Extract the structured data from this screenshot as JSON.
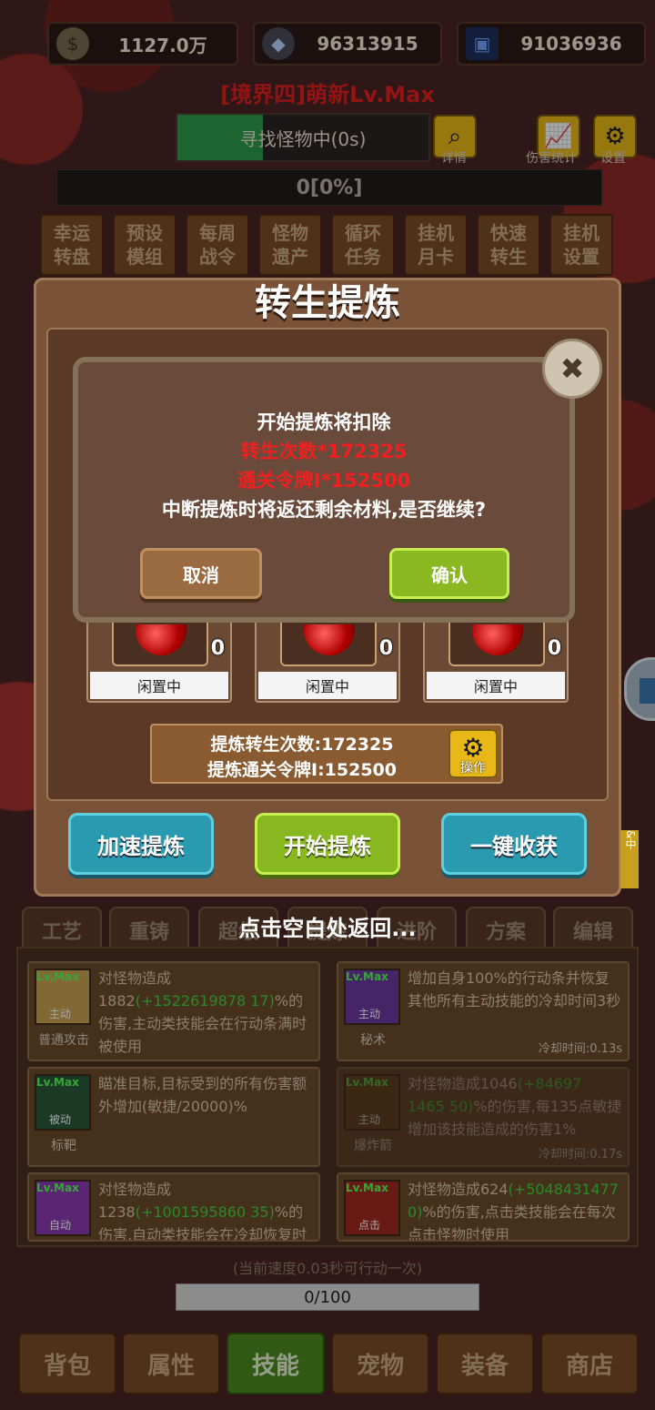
{
  "resources": {
    "gold": "1127.0万",
    "crystal": "96313915",
    "cards": "91036936"
  },
  "realm_title": "[境界四]萌新Lv.Max",
  "search": {
    "label": "寻找怪物中(0s)",
    "detail_label": "详情",
    "progress_fraction": 0.34
  },
  "top_icons": {
    "damage_stats": "伤害统计",
    "settings": "设置"
  },
  "exp_progress": "0[0%]",
  "menu": [
    {
      "l1": "幸运",
      "l2": "转盘"
    },
    {
      "l1": "预设",
      "l2": "模组"
    },
    {
      "l1": "每周",
      "l2": "战令"
    },
    {
      "l1": "怪物",
      "l2": "遗产"
    },
    {
      "l1": "循环",
      "l2": "任务"
    },
    {
      "l1": "挂机",
      "l2": "月卡"
    },
    {
      "l1": "快速",
      "l2": "转生"
    },
    {
      "l1": "挂机",
      "l2": "设置"
    }
  ],
  "panel": {
    "title": "转生提炼",
    "slots": [
      {
        "count": "0",
        "state": "闲置中"
      },
      {
        "count": "0",
        "state": "闲置中"
      },
      {
        "count": "0",
        "state": "闲置中"
      }
    ],
    "info_line1": "提炼转生次数:172325",
    "info_line2": "提炼通关令牌I:152500",
    "operate_label": "操作",
    "btn_speed": "加速提炼",
    "btn_start": "开始提炼",
    "btn_harvest": "一键收获"
  },
  "dialog": {
    "line1": "开始提炼将扣除",
    "line2": "转生次数*172325",
    "line3": "通关令牌I*152500",
    "line4": "中断提炼时将返还剩余材料,是否继续?",
    "cancel": "取消",
    "confirm": "确认",
    "close_glyph": "✖"
  },
  "hint": "点击空白处返回...",
  "skill_tabs": [
    "工艺",
    "重铸",
    "超级",
    "提炼",
    "进阶",
    "方案",
    "编辑"
  ],
  "skills": [
    {
      "lv": "Lv.Max",
      "tag": "主动",
      "name": "普通攻击",
      "desc_a": "对怪物造成1882",
      "desc_hl": "(+1522619878 17)",
      "desc_b": "%的伤害,主动类技能会在行动条满时被使用",
      "cd": "",
      "color": "#c8a050"
    },
    {
      "lv": "Lv.Max",
      "tag": "主动",
      "name": "秘术",
      "desc_a": "增加自身100%的行动条并恢复其他所有主动技能的冷却时间3秒",
      "desc_hl": "",
      "desc_b": "",
      "cd": "冷却时间:0.13s",
      "color": "#6a3aa0"
    },
    {
      "lv": "Lv.Max",
      "tag": "被动",
      "name": "标靶",
      "desc_a": "瞄准目标,目标受到的所有伤害额外增加(敏捷/20000)%",
      "desc_hl": "",
      "desc_b": "",
      "cd": "",
      "color": "#2a5a3a"
    },
    {
      "lv": "Lv.Max",
      "tag": "主动",
      "name": "爆炸箭",
      "desc_a": "对怪物造成1046",
      "desc_hl": "(+84697 1465 50)",
      "desc_b": "%的伤害,每135点敏捷增加该技能造成的伤害1%",
      "cd": "冷却时间:0.17s",
      "color": "#6a4a20"
    },
    {
      "lv": "Lv.Max",
      "tag": "自动",
      "name": "",
      "desc_a": "对怪物造成1238",
      "desc_hl": "(+1001595860 35)",
      "desc_b": "%的伤害,自动类技能会在冷却恢复时立刻自动使用",
      "cd": "",
      "color": "#8a3ab0"
    },
    {
      "lv": "Lv.Max",
      "tag": "点击",
      "name": "",
      "desc_a": "对怪物造成624",
      "desc_hl": "(+5048431477 0)",
      "desc_b": "%的伤害,点击类技能会在每次点击怪物时使用",
      "cd": "",
      "color": "#a02a20"
    }
  ],
  "speed_text": "(当前速度0.03秒可行动一次)",
  "action_bar": "0/100",
  "nav": [
    "背包",
    "属性",
    "技能",
    "宠物",
    "装备",
    "商店"
  ],
  "side_badge": "&中"
}
